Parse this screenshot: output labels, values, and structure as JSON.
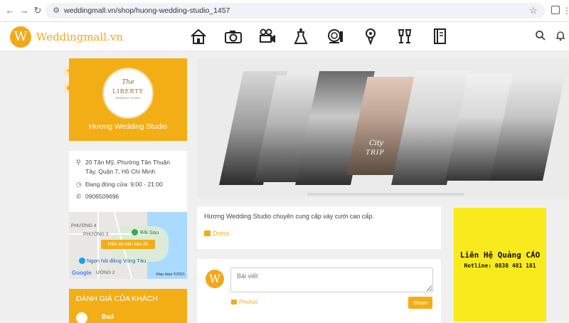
{
  "browser": {
    "url": "weddingmall.vn/shop/huong-wedding-studio_1457"
  },
  "header": {
    "logo_letter": "W",
    "logo_text": "Weddingmall.vn",
    "categories": [
      {
        "name": "home-icon"
      },
      {
        "name": "camera-icon"
      },
      {
        "name": "video-camera-icon"
      },
      {
        "name": "dress-icon"
      },
      {
        "name": "makeup-icon"
      },
      {
        "name": "bouquet-icon"
      },
      {
        "name": "champagne-icon"
      },
      {
        "name": "notebook-icon"
      }
    ]
  },
  "profile": {
    "logo_script": "The",
    "logo_word": "LIBERTY",
    "logo_sub": "WEDDING STUDIO",
    "studio_name": "Hương Wedding Studio"
  },
  "info": {
    "address": "20 Tân Mỹ, Phường Tân Thuận Tây, Quận 7, Hồ Chí Minh",
    "hours": "Đang đóng cửa: 9:00 - 21:00",
    "phone": "0906509696"
  },
  "map": {
    "label_phuong4": "PHƯỜNG 4",
    "label_phuong3": "PHƯỜNG 3",
    "label_baisau": "Bãi Sau",
    "button": "Hiển thị trên bản đồ",
    "label_lighthouse": "Ngọn hải đăng Vũng Tàu",
    "label_phuong2": "ƯỜNG 2",
    "google": "Google",
    "map_data": "Map data ©2021"
  },
  "review": {
    "title": "ĐÁNH GIÁ CỦA KHÁCH",
    "first_name": "Bad"
  },
  "cover": {
    "overlay_text_1": "City",
    "overlay_text_2": "TRIP"
  },
  "description": {
    "text": "Hương Wedding Studio chuyên cung cấp váy cưới cao cấp.",
    "tag": "Dress"
  },
  "post": {
    "avatar_letter": "W",
    "placeholder": "Bài viết",
    "photos": "Photos",
    "share": "Share"
  },
  "ad": {
    "title": "Liên Hệ Quảng CÁO",
    "hotline": "Hotline: 0838 481 181"
  }
}
